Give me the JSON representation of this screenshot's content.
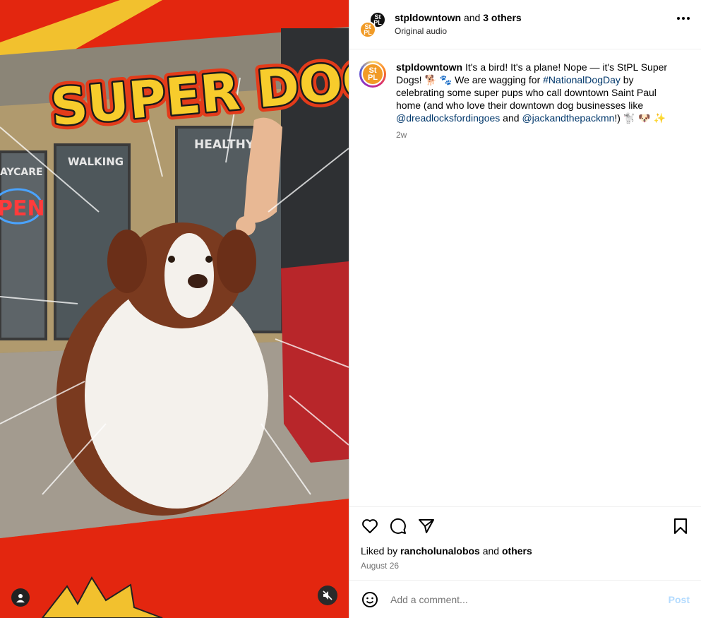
{
  "media": {
    "headline": "SUPER DOGS",
    "sign_healthy": "HEALTHY P",
    "sign_walking": "WALKING",
    "sign_daycare": "AYCARE",
    "sign_open": "PEN",
    "colors": {
      "red": "#e3260f",
      "yellow": "#f2c12e"
    }
  },
  "header": {
    "username": "stpldowntown",
    "and_text": " and ",
    "others": "3 others",
    "subtitle": "Original audio",
    "avatar_front": "St PL",
    "avatar_back": "St PL"
  },
  "caption": {
    "avatar": "St PL",
    "username": "stpldowntown",
    "text_1": " It's a bird! It's a plane! Nope — it's StPL Super Dogs! 🐕 🐾 We are wagging for ",
    "hashtag": "#NationalDogDay",
    "text_2": " by celebrating some super pups who call downtown Saint Paul home (and who love their downtown dog businesses like ",
    "mention_1": "@dreadlocksfordingoes",
    "text_3": " and ",
    "mention_2": "@jackandthepackmn",
    "text_4": "!) 🐩 🐶 ✨",
    "time": "2w"
  },
  "actions": {
    "liked_prefix": "Liked by ",
    "liked_user": "rancholunalobos",
    "liked_mid": " and ",
    "liked_others": "others",
    "date": "August 26"
  },
  "comment": {
    "placeholder": "Add a comment...",
    "post_label": "Post"
  }
}
